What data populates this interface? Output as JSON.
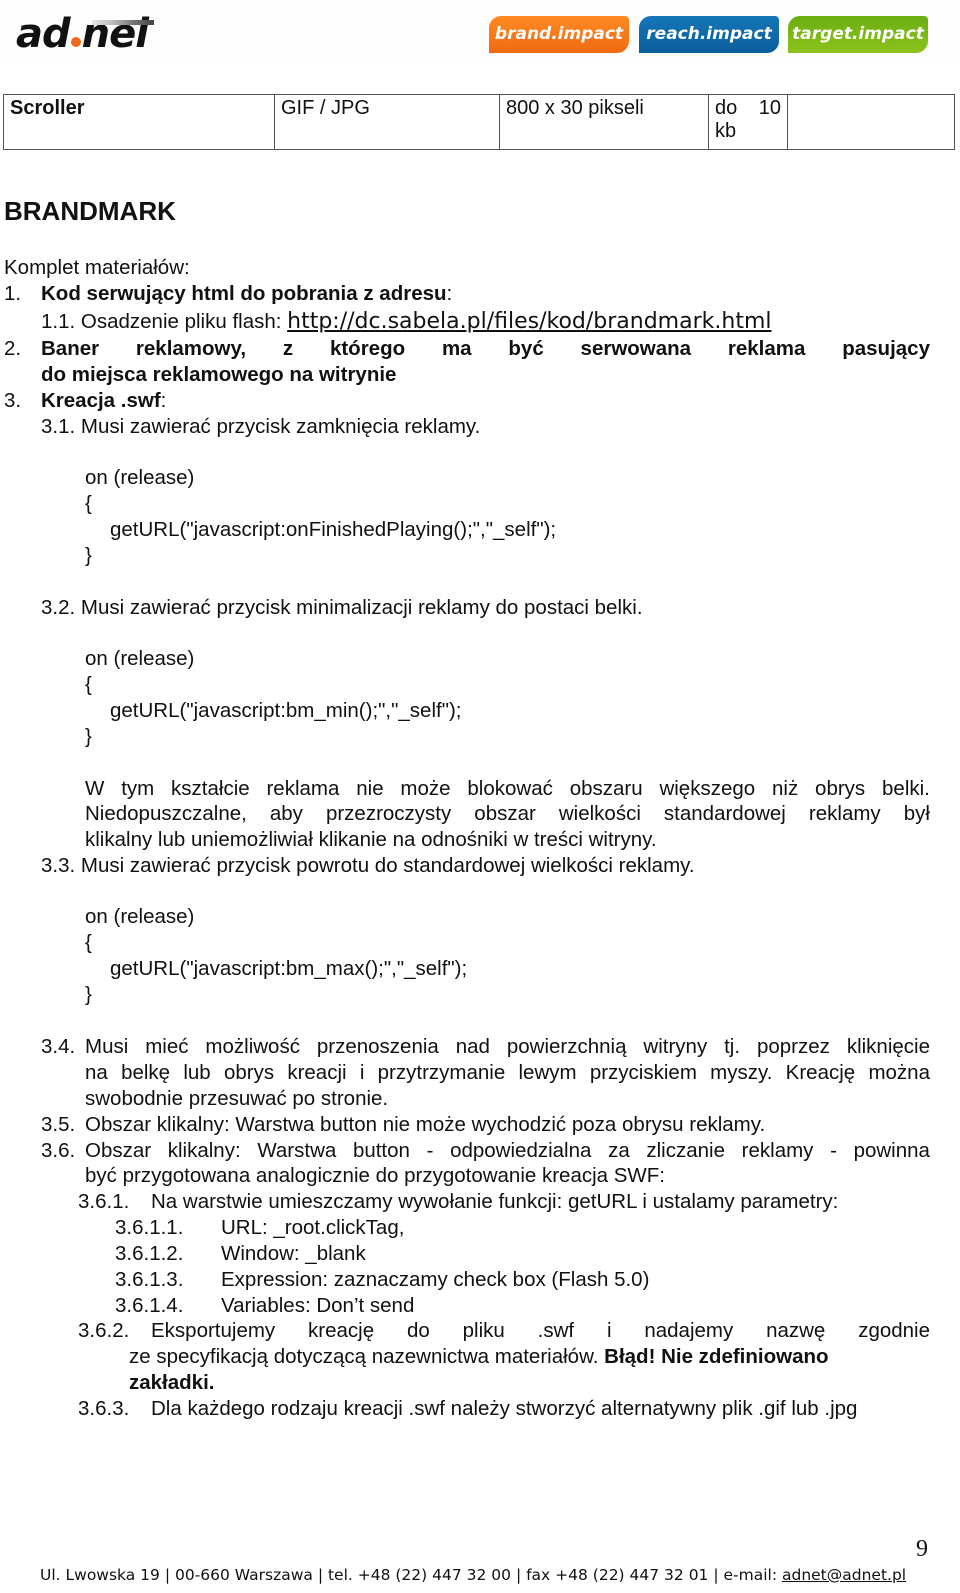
{
  "header": {
    "logo": {
      "left": "ad",
      "right": "nel"
    },
    "tabs": [
      {
        "label": "brand.impact",
        "color": "#f47a1a"
      },
      {
        "label": "reach.impact",
        "color": "#0e6aa8"
      },
      {
        "label": "target.impact",
        "color": "#7cb817"
      }
    ]
  },
  "spec_table": {
    "cells": [
      "Scroller",
      "GIF / JPG",
      "800 x 30 pikseli",
      "do 10 kb",
      ""
    ]
  },
  "section": {
    "title": "BRANDMARK",
    "intro": "Komplet materiałów:",
    "item1_num": "1.",
    "item1_text": "Kod serwujący html do pobrania z adresu",
    "item1_colon": ":",
    "item1_1_label": "1.1. Osadzenie pliku flash: ",
    "item1_1_link": "http://dc.sabela.pl/files/kod/brandmark.html",
    "item2_num": "2.",
    "item2_words": [
      "Baner",
      "reklamowy,",
      "z",
      "którego",
      "ma",
      "być",
      "serwowana",
      "reklama",
      "pasujący"
    ],
    "item2_line2": "do miejsca reklamowego na witrynie",
    "item3_num": "3.",
    "item3_text": "Kreacja .swf",
    "item3_colon": ":",
    "item3_1": "3.1. Musi zawierać przycisk zamknięcia reklamy.",
    "code1": [
      "on (release)",
      "{",
      "getURL(\"javascript:onFinishedPlaying();\",\"_self\");",
      "}"
    ],
    "item3_2": "3.2. Musi zawierać przycisk minimalizacji reklamy do postaci belki.",
    "code2": [
      "on (release)",
      "{",
      "getURL(\"javascript:bm_min();\",\"_self\");",
      "}"
    ],
    "para_words1": [
      "W",
      "tym",
      "kształcie",
      "reklama",
      "nie",
      "może",
      "blokować",
      "obszaru",
      "większego",
      "niż",
      "obrys",
      "belki."
    ],
    "para_words2": [
      "Niedopuszczalne,",
      "aby",
      "przezroczysty",
      "obszar",
      "wielkości",
      "standardowej",
      "reklamy",
      "był"
    ],
    "para_line3": "klikalny lub uniemożliwiał klikanie na odnośniki w treści witryny.",
    "item3_3": "3.3. Musi zawierać przycisk powrotu do standardowej wielkości reklamy.",
    "code3": [
      "on (release)",
      "{",
      "getURL(\"javascript:bm_max();\",\"_self\");",
      "}"
    ],
    "item3_4_num": "3.4.",
    "item3_4_words1": [
      "Musi",
      "mieć",
      "możliwość",
      "przenoszenia",
      "nad",
      "powierzchnią",
      "witryny",
      "tj.",
      "poprzez",
      "kliknięcie"
    ],
    "item3_4_words2": [
      "na",
      "belkę",
      "lub",
      "obrys",
      "kreacji",
      "i",
      "przytrzymanie",
      "lewym",
      "przyciskiem",
      "myszy.",
      "Kreację",
      "można"
    ],
    "item3_4_line3": "swobodnie przesuwać po stronie.",
    "item3_5_num": "3.5.",
    "item3_5": "Obszar klikalny: Warstwa button nie może wychodzić poza obrysu reklamy.",
    "item3_6_num": "3.6.",
    "item3_6_words1": [
      "Obszar",
      "klikalny:",
      "Warstwa",
      "button",
      "-",
      "odpowiedzialna",
      "za",
      "zliczanie",
      "reklamy",
      "-",
      "powinna"
    ],
    "item3_6_line2": "być przygotowana analogicznie do przygotowanie kreacja SWF:",
    "item3_6_1_num": "3.6.1.",
    "item3_6_1": "Na warstwie umieszczamy wywołanie funkcji: getURL i ustalamy parametry:",
    "sub": [
      {
        "num": "3.6.1.1.",
        "text": "URL: _root.clickTag,"
      },
      {
        "num": "3.6.1.2.",
        "text": "Window: _blank"
      },
      {
        "num": "3.6.1.3.",
        "text": "Expression: zaznaczamy check box (Flash 5.0)"
      },
      {
        "num": "3.6.1.4.",
        "text": "Variables: Don’t send"
      }
    ],
    "item3_6_2_num": "3.6.2.",
    "item3_6_2_words1": [
      "Eksportujemy",
      "kreację",
      "do",
      "pliku",
      ".swf",
      "i",
      "nadajemy",
      "nazwę",
      "zgodnie"
    ],
    "item3_6_2_line2a": "ze specyfikacją dotyczącą nazewnictwa materiałów. ",
    "item3_6_2_line2b": "Błąd! Nie zdefiniowano",
    "item3_6_2_line3": "zakładki.",
    "item3_6_3_num": "3.6.3.",
    "item3_6_3": "Dla każdego rodzaju kreacji .swf należy stworzyć alternatywny plik .gif lub .jpg"
  },
  "footer": {
    "address": "Ul. Lwowska 19 | 00-660 Warszawa | tel. +48 (22) 447 32 00 | fax +48 (22) 447 32 01 | e-mail: ",
    "email": "adnet@adnet.pl",
    "page_number": "9"
  }
}
